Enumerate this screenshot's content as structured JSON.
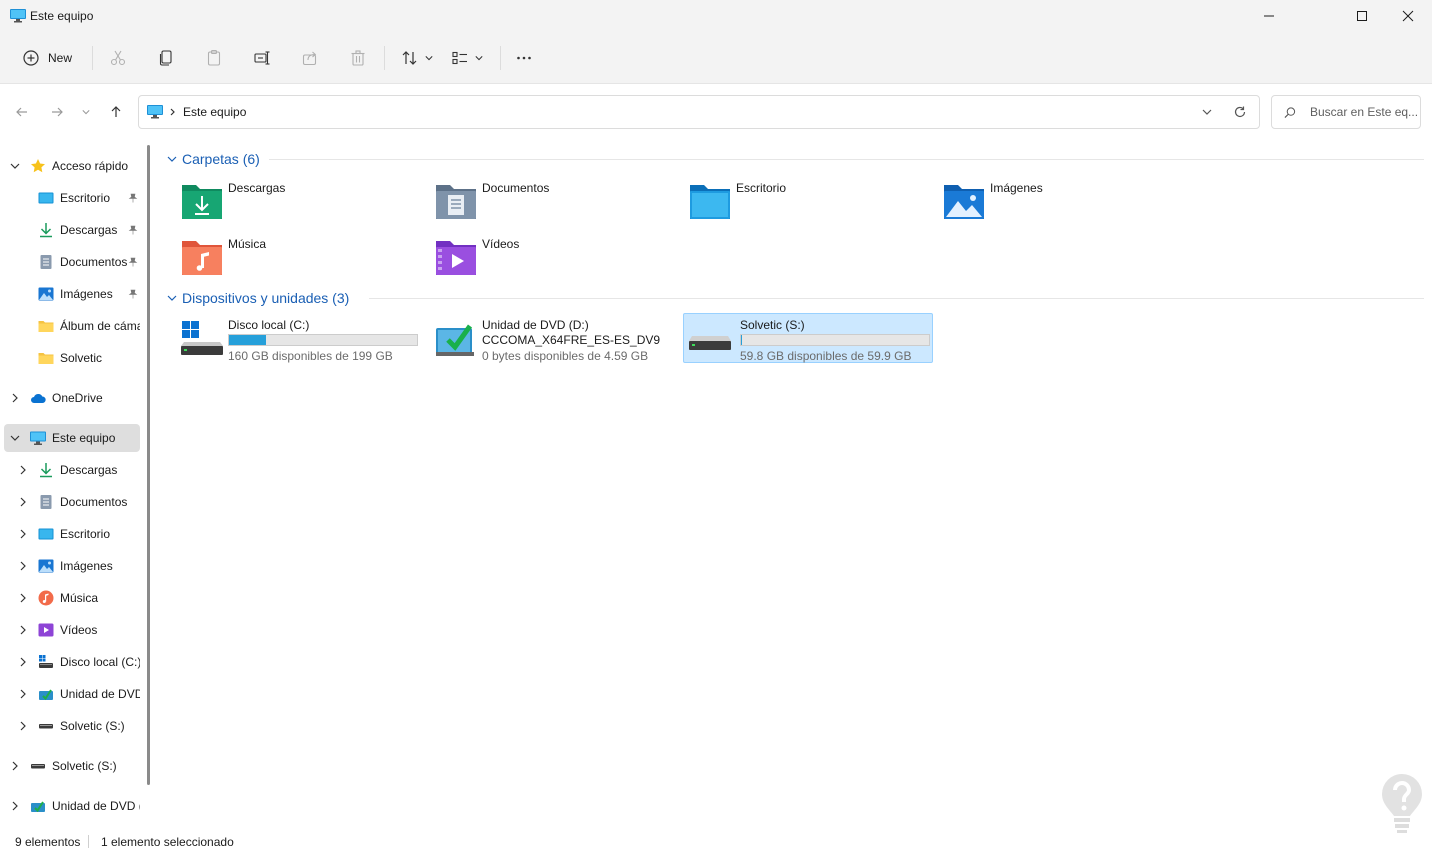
{
  "window": {
    "title": "Este equipo"
  },
  "toolbar": {
    "new_label": "New",
    "more_label": "..."
  },
  "address": {
    "crumb": "Este equipo",
    "search_placeholder": "Buscar en Este eq..."
  },
  "nav": {
    "quick_access": {
      "label": "Acceso rápido",
      "items": [
        {
          "label": "Escritorio",
          "icon": "desktop-icon",
          "pinned": true
        },
        {
          "label": "Descargas",
          "icon": "download-icon",
          "pinned": true
        },
        {
          "label": "Documentos",
          "icon": "document-icon",
          "pinned": true
        },
        {
          "label": "Imágenes",
          "icon": "pictures-icon",
          "pinned": true
        },
        {
          "label": "Álbum de cámara",
          "icon": "folder-icon",
          "pinned": false
        },
        {
          "label": "Solvetic",
          "icon": "folder-icon",
          "pinned": false
        }
      ]
    },
    "onedrive": {
      "label": "OneDrive"
    },
    "this_pc": {
      "label": "Este equipo",
      "items": [
        {
          "label": "Descargas",
          "icon": "download-icon"
        },
        {
          "label": "Documentos",
          "icon": "document-icon"
        },
        {
          "label": "Escritorio",
          "icon": "desktop-icon"
        },
        {
          "label": "Imágenes",
          "icon": "pictures-icon"
        },
        {
          "label": "Música",
          "icon": "music-icon"
        },
        {
          "label": "Vídeos",
          "icon": "video-icon"
        },
        {
          "label": "Disco local (C:)",
          "icon": "windows-drive-icon"
        },
        {
          "label": "Unidad de DVD (D:)",
          "icon": "dvd-drive-icon"
        },
        {
          "label": "Solvetic (S:)",
          "icon": "usb-drive-icon"
        }
      ]
    },
    "solvetic_root": {
      "label": "Solvetic (S:)"
    },
    "dvd_root": {
      "label": "Unidad de DVD (D:)"
    }
  },
  "content": {
    "folders_group": "Carpetas (6)",
    "folders": [
      {
        "name": "Descargas",
        "icon": "downloads-folder-icon"
      },
      {
        "name": "Documentos",
        "icon": "documents-folder-icon"
      },
      {
        "name": "Escritorio",
        "icon": "desktop-folder-icon"
      },
      {
        "name": "Imágenes",
        "icon": "pictures-folder-icon"
      },
      {
        "name": "Música",
        "icon": "music-folder-icon"
      },
      {
        "name": "Vídeos",
        "icon": "videos-folder-icon"
      }
    ],
    "devices_group": "Dispositivos y unidades (3)",
    "devices": [
      {
        "name": "Disco local (C:)",
        "sub": "160 GB disponibles de 199 GB",
        "used_fraction": 0.196,
        "icon": "windows-drive-icon",
        "selected": false
      },
      {
        "name": "Unidad de DVD (D:)",
        "name2": "CCCOMA_X64FRE_ES-ES_DV9",
        "sub": "0 bytes disponibles de 4.59 GB",
        "icon": "dvd-drive-icon",
        "selected": false
      },
      {
        "name": "Solvetic (S:)",
        "sub": "59.8 GB disponibles de 59.9 GB",
        "used_fraction": 0.002,
        "icon": "usb-drive-icon",
        "selected": true
      }
    ]
  },
  "status": {
    "count": "9 elementos",
    "selection": "1 elemento seleccionado"
  },
  "colors": {
    "accent": "#1a5fb4",
    "bar_fill": "#26a0da",
    "selected_bg": "#cce8ff"
  }
}
